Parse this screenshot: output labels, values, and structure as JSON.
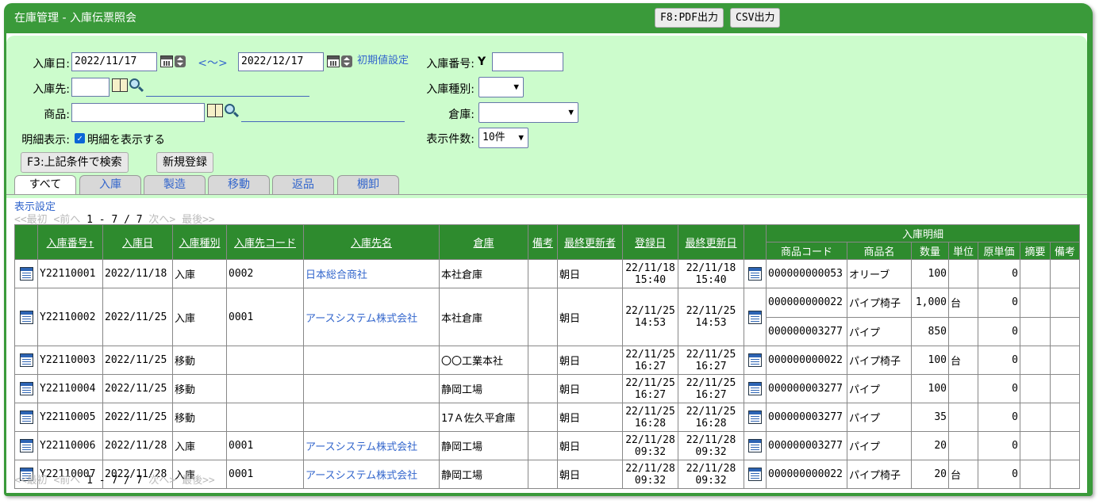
{
  "window": {
    "title": "在庫管理 - 入庫伝票照会"
  },
  "header_buttons": {
    "pdf": "F8:PDF出力",
    "csv": "CSV出力"
  },
  "search": {
    "date_label": "入庫日:",
    "date_from": "2022/11/17",
    "range_link": "<～>",
    "date_to": "2022/12/17",
    "initial_link": "初期値設定",
    "number_label": "入庫番号:",
    "number_prefix": "Y",
    "number_value": "",
    "supplier_label": "入庫先:",
    "supplier_code": "",
    "type_label": "入庫種別:",
    "type_value": "",
    "product_label": "商品:",
    "product_code": "",
    "warehouse_label": "倉庫:",
    "warehouse_value": "",
    "detail_label": "明細表示:",
    "detail_check_label": "明細を表示する",
    "count_label": "表示件数:",
    "count_value": "10件",
    "search_button": "F3:上記条件で検索",
    "new_button": "新規登録"
  },
  "tabs": [
    "すべて",
    "入庫",
    "製造",
    "移動",
    "返品",
    "棚卸"
  ],
  "display_settings": "表示設定",
  "pager": {
    "first": "<<最初",
    "prev": "<前へ",
    "range": "1 - 7 / 7",
    "next": "次へ>",
    "last": "最後>>"
  },
  "columns": {
    "number": "入庫番号↑",
    "date": "入庫日",
    "type": "入庫種別",
    "code": "入庫先コード",
    "name": "入庫先名",
    "warehouse": "倉庫",
    "note": "備考",
    "updater": "最終更新者",
    "registered": "登録日",
    "updated": "最終更新日",
    "detail_group": "入庫明細",
    "product_code": "商品コード",
    "product_name": "商品名",
    "qty": "数量",
    "unit": "単位",
    "unit_price": "原単価",
    "summary": "摘要",
    "detail_note": "備考"
  },
  "rows": [
    {
      "number": "Y22110001",
      "date": "2022/11/18",
      "type": "入庫",
      "code": "0002",
      "name": "日本総合商社",
      "warehouse": "本社倉庫",
      "note": "",
      "updater": "朝日",
      "reg_date": "22/11/18",
      "reg_time": "15:40",
      "upd_date": "22/11/18",
      "upd_time": "15:40",
      "details": [
        {
          "code": "000000000053",
          "name": "オリーブ",
          "qty": "100",
          "unit": "",
          "price": "0"
        }
      ]
    },
    {
      "number": "Y22110002",
      "date": "2022/11/25",
      "type": "入庫",
      "code": "0001",
      "name": "アースシステム株式会社",
      "warehouse": "本社倉庫",
      "note": "",
      "updater": "朝日",
      "reg_date": "22/11/25",
      "reg_time": "14:53",
      "upd_date": "22/11/25",
      "upd_time": "14:53",
      "details": [
        {
          "code": "000000000022",
          "name": "パイプ椅子",
          "qty": "1,000",
          "unit": "台",
          "price": "0"
        },
        {
          "code": "000000003277",
          "name": "パイプ",
          "qty": "850",
          "unit": "",
          "price": "0"
        }
      ]
    },
    {
      "number": "Y22110003",
      "date": "2022/11/25",
      "type": "移動",
      "code": "",
      "name": "",
      "warehouse": "〇〇工業本社",
      "note": "",
      "updater": "朝日",
      "reg_date": "22/11/25",
      "reg_time": "16:27",
      "upd_date": "22/11/25",
      "upd_time": "16:27",
      "details": [
        {
          "code": "000000000022",
          "name": "パイプ椅子",
          "qty": "100",
          "unit": "台",
          "price": "0"
        }
      ]
    },
    {
      "number": "Y22110004",
      "date": "2022/11/25",
      "type": "移動",
      "code": "",
      "name": "",
      "warehouse": "静岡工場",
      "note": "",
      "updater": "朝日",
      "reg_date": "22/11/25",
      "reg_time": "16:27",
      "upd_date": "22/11/25",
      "upd_time": "16:27",
      "details": [
        {
          "code": "000000003277",
          "name": "パイプ",
          "qty": "100",
          "unit": "",
          "price": "0"
        }
      ]
    },
    {
      "number": "Y22110005",
      "date": "2022/11/25",
      "type": "移動",
      "code": "",
      "name": "",
      "warehouse": "17Ａ佐久平倉庫",
      "note": "",
      "updater": "朝日",
      "reg_date": "22/11/25",
      "reg_time": "16:28",
      "upd_date": "22/11/25",
      "upd_time": "16:28",
      "details": [
        {
          "code": "000000003277",
          "name": "パイプ",
          "qty": "35",
          "unit": "",
          "price": "0"
        }
      ]
    },
    {
      "number": "Y22110006",
      "date": "2022/11/28",
      "type": "入庫",
      "code": "0001",
      "name": "アースシステム株式会社",
      "warehouse": "静岡工場",
      "note": "",
      "updater": "朝日",
      "reg_date": "22/11/28",
      "reg_time": "09:32",
      "upd_date": "22/11/28",
      "upd_time": "09:32",
      "details": [
        {
          "code": "000000003277",
          "name": "パイプ",
          "qty": "20",
          "unit": "",
          "price": "0"
        }
      ]
    },
    {
      "number": "Y22110007",
      "date": "2022/11/28",
      "type": "入庫",
      "code": "0001",
      "name": "アースシステム株式会社",
      "warehouse": "静岡工場",
      "note": "",
      "updater": "朝日",
      "reg_date": "22/11/28",
      "reg_time": "09:32",
      "upd_date": "22/11/28",
      "upd_time": "09:32",
      "details": [
        {
          "code": "000000000022",
          "name": "パイプ椅子",
          "qty": "20",
          "unit": "台",
          "price": "0"
        }
      ]
    }
  ]
}
